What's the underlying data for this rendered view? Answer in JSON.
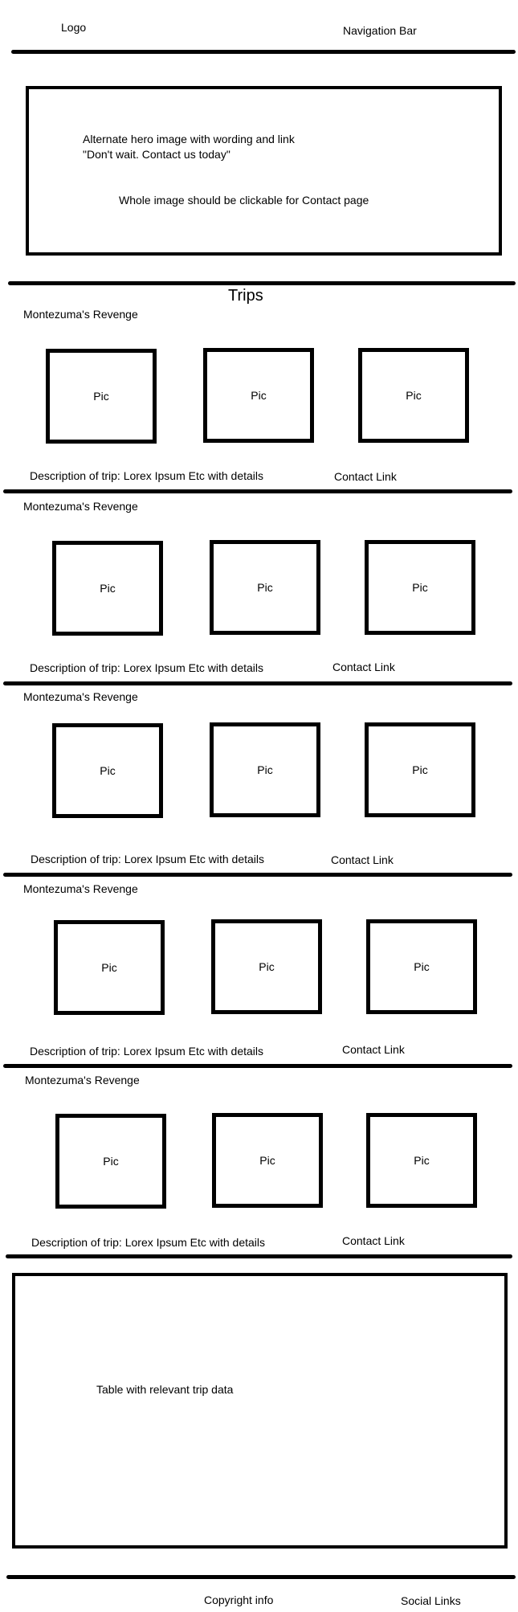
{
  "header": {
    "logo": "Logo",
    "nav": "Navigation Bar"
  },
  "hero": {
    "line1": "Alternate hero image with wording and link",
    "line2": "\"Don't wait. Contact us today\"",
    "note": "Whole image should be clickable for Contact page"
  },
  "trips": {
    "heading": "Trips",
    "items": [
      {
        "name": "Montezuma's Revenge",
        "pics": [
          "Pic",
          "Pic",
          "Pic"
        ],
        "description": "Description of trip: Lorex Ipsum Etc with details",
        "contact": "Contact Link"
      },
      {
        "name": "Montezuma's Revenge",
        "pics": [
          "Pic",
          "Pic",
          "Pic"
        ],
        "description": "Description of trip: Lorex Ipsum Etc with details",
        "contact": "Contact Link"
      },
      {
        "name": "Montezuma's Revenge",
        "pics": [
          "Pic",
          "Pic",
          "Pic"
        ],
        "description": "Description of trip: Lorex Ipsum Etc with details",
        "contact": "Contact Link"
      },
      {
        "name": "Montezuma's Revenge",
        "pics": [
          "Pic",
          "Pic",
          "Pic"
        ],
        "description": "Description of trip: Lorex Ipsum Etc with details",
        "contact": "Contact Link"
      },
      {
        "name": "Montezuma's Revenge",
        "pics": [
          "Pic",
          "Pic",
          "Pic"
        ],
        "description": "Description of trip: Lorex Ipsum Etc with details",
        "contact": "Contact Link"
      }
    ]
  },
  "table": {
    "label": "Table with relevant trip data"
  },
  "footer": {
    "copyright": "Copyright info",
    "social": "Social Links"
  }
}
